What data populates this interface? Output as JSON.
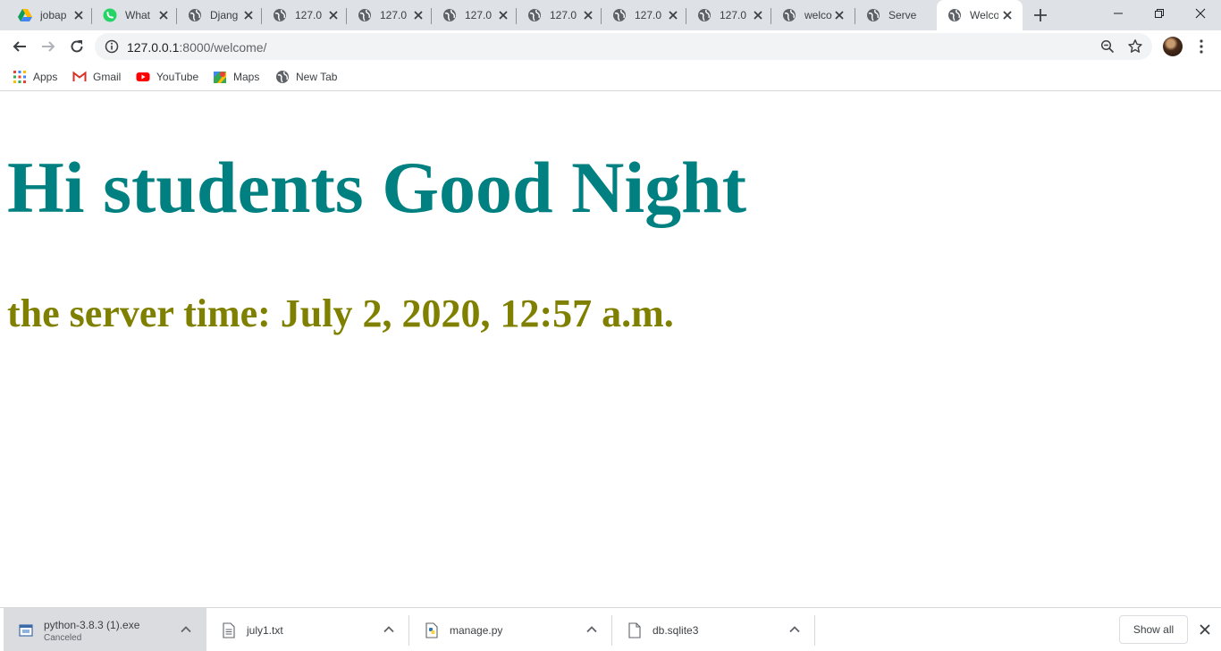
{
  "browser": {
    "tabs": [
      {
        "title": "jobap",
        "icon": "google-drive-icon"
      },
      {
        "title": "What",
        "icon": "whatsapp-icon"
      },
      {
        "title": "Djang",
        "icon": "globe-icon"
      },
      {
        "title": "127.0",
        "icon": "globe-icon"
      },
      {
        "title": "127.0",
        "icon": "globe-icon"
      },
      {
        "title": "127.0",
        "icon": "globe-icon"
      },
      {
        "title": "127.0",
        "icon": "globe-icon"
      },
      {
        "title": "127.0",
        "icon": "globe-icon"
      },
      {
        "title": "127.0",
        "icon": "globe-icon"
      },
      {
        "title": "welco",
        "icon": "globe-icon"
      },
      {
        "title": "Serve",
        "icon": "globe-icon"
      },
      {
        "title": "Welco",
        "icon": "globe-icon",
        "active": true
      }
    ],
    "address": {
      "host": "127.0.0.1",
      "rest": ":8000/welcome/"
    },
    "bookmarks": [
      {
        "label": "Apps",
        "icon": "apps-grid-icon"
      },
      {
        "label": "Gmail",
        "icon": "gmail-icon"
      },
      {
        "label": "YouTube",
        "icon": "youtube-icon"
      },
      {
        "label": "Maps",
        "icon": "maps-icon"
      },
      {
        "label": "New Tab",
        "icon": "globe-icon"
      }
    ]
  },
  "page": {
    "heading": "Hi students Good Night",
    "heading_color": "#008080",
    "subheading": "the server time: July 2, 2020, 12:57 a.m.",
    "subheading_color": "#808000"
  },
  "downloads": {
    "items": [
      {
        "name": "python-3.8.3 (1).exe",
        "status": "Canceled",
        "icon": "installer-icon"
      },
      {
        "name": "july1.txt",
        "status": "",
        "icon": "text-file-icon"
      },
      {
        "name": "manage.py",
        "status": "",
        "icon": "python-file-icon"
      },
      {
        "name": "db.sqlite3",
        "status": "",
        "icon": "file-icon"
      }
    ],
    "show_all_label": "Show all"
  }
}
